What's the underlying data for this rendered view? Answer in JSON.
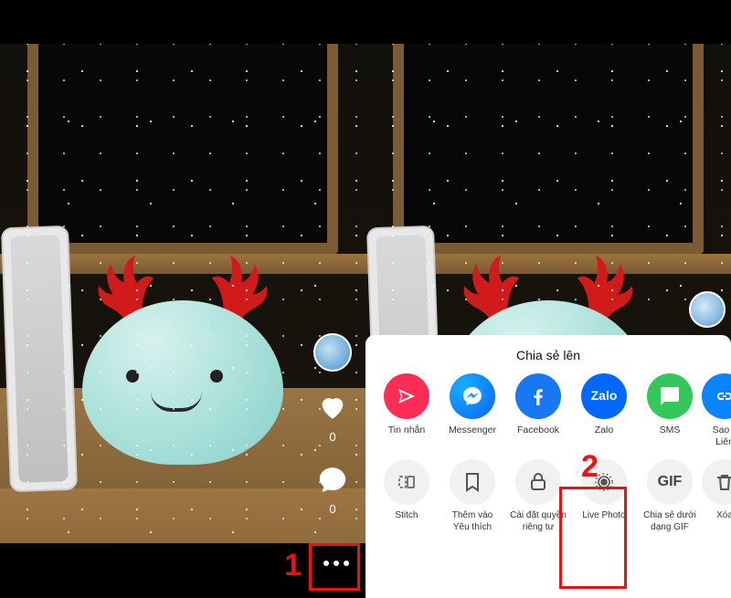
{
  "left": {
    "like_count": "0",
    "comment_count": "0"
  },
  "right": {
    "sheet_title": "Chia sẻ lên",
    "share_items": [
      {
        "key": "dm",
        "label": "Tin nhắn"
      },
      {
        "key": "messenger",
        "label": "Messenger"
      },
      {
        "key": "facebook",
        "label": "Facebook"
      },
      {
        "key": "zalo",
        "label": "Zalo"
      },
      {
        "key": "sms",
        "label": "SMS"
      },
      {
        "key": "copylink",
        "label": "Sao c\nLiên"
      }
    ],
    "action_items": [
      {
        "key": "stitch",
        "label": "Stitch"
      },
      {
        "key": "favorite",
        "label": "Thêm vào\nYêu thích"
      },
      {
        "key": "privacy",
        "label": "Cài đặt quyền\nriêng tư"
      },
      {
        "key": "livephoto",
        "label": "Live Photo"
      },
      {
        "key": "gif",
        "label": "Chia sẻ dưới\ndạng GIF"
      },
      {
        "key": "delete",
        "label": "Xóa"
      }
    ]
  },
  "annotations": {
    "step1": "1",
    "step2": "2"
  }
}
